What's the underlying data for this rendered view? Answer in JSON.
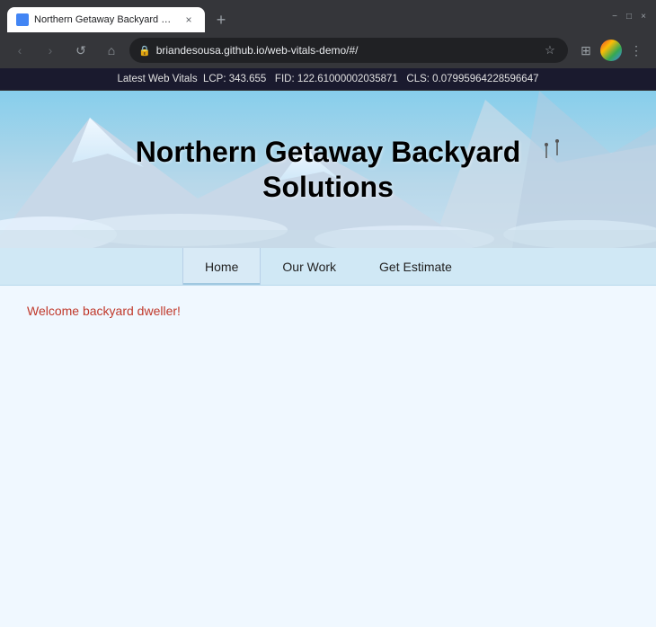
{
  "browser": {
    "tab": {
      "title": "Northern Getaway Backyard Sol...",
      "favicon_color": "#4285f4"
    },
    "new_tab_label": "+",
    "window_controls": {
      "minimize": "−",
      "maximize": "□",
      "close": "×"
    },
    "nav": {
      "back": "‹",
      "forward": "›",
      "refresh": "↺",
      "home": "⌂"
    },
    "url": "briandesousa.github.io/web-vitals-demo/#/",
    "lock_icon": "🔒"
  },
  "web_vitals": {
    "label": "Latest Web Vitals",
    "lcp_label": "LCP:",
    "lcp_value": "343.655",
    "fid_label": "FID:",
    "fid_value": "122.61000002035871",
    "cls_label": "CLS:",
    "cls_value": "0.07995964228596647"
  },
  "site": {
    "title_line1": "Northern Getaway Backyard",
    "title_line2": "Solutions",
    "nav": {
      "items": [
        {
          "label": "Home",
          "active": true
        },
        {
          "label": "Our Work",
          "active": false
        },
        {
          "label": "Get Estimate",
          "active": false
        }
      ]
    },
    "welcome_message": "Welcome backyard dweller!"
  }
}
